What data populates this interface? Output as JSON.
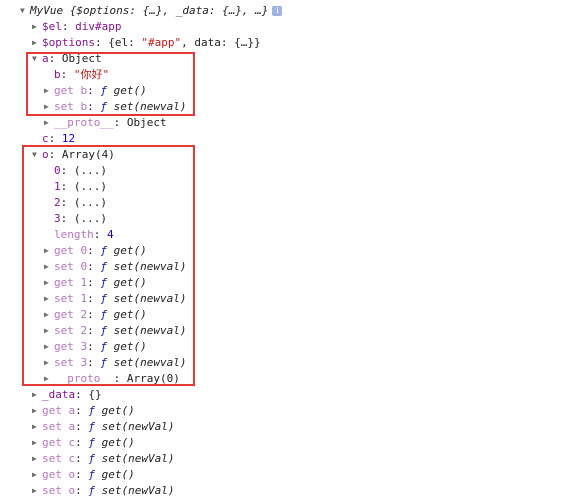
{
  "root": {
    "name": "MyVue",
    "preview": "{$options: {…}, _data: {…}, …}",
    "info": "i"
  },
  "el": {
    "key": "$el",
    "value": "div#app"
  },
  "options": {
    "key": "$options",
    "v1": "{el: ",
    "v2": "\"#app\"",
    "v3": ", data: {…}}"
  },
  "a": {
    "key": "a",
    "type": "Object",
    "b": {
      "key": "b",
      "value": "\"你好\""
    },
    "getb": {
      "label": "get b",
      "fn": "ƒ",
      "sig": "get()"
    },
    "setb": {
      "label": "set b",
      "fn": "ƒ",
      "sig": "set(newval)"
    },
    "proto": {
      "key": "__proto__",
      "value": "Object"
    }
  },
  "c": {
    "key": "c",
    "value": "12"
  },
  "o": {
    "key": "o",
    "type": "Array(4)",
    "items": [
      {
        "key": "0",
        "value": "(...)"
      },
      {
        "key": "1",
        "value": "(...)"
      },
      {
        "key": "2",
        "value": "(...)"
      },
      {
        "key": "3",
        "value": "(...)"
      }
    ],
    "length": {
      "key": "length",
      "value": "4"
    },
    "accessors": [
      {
        "label": "get 0",
        "sig": "get()"
      },
      {
        "label": "set 0",
        "sig": "set(newval)"
      },
      {
        "label": "get 1",
        "sig": "get()"
      },
      {
        "label": "set 1",
        "sig": "set(newval)"
      },
      {
        "label": "get 2",
        "sig": "get()"
      },
      {
        "label": "set 2",
        "sig": "set(newval)"
      },
      {
        "label": "get 3",
        "sig": "get()"
      },
      {
        "label": "set 3",
        "sig": "set(newval)"
      }
    ],
    "proto": {
      "key": "__proto__",
      "value": "Array(0)"
    }
  },
  "data_row": {
    "key": "_data",
    "value": "{}"
  },
  "accessors": [
    {
      "label": "get a",
      "sig": "get()"
    },
    {
      "label": "set a",
      "sig": "set(newVal)"
    },
    {
      "label": "get c",
      "sig": "get()"
    },
    {
      "label": "set c",
      "sig": "set(newVal)"
    },
    {
      "label": "get o",
      "sig": "get()"
    },
    {
      "label": "set o",
      "sig": "set(newVal)"
    }
  ],
  "fn_symbol": "ƒ",
  "colors": {
    "box": "#e53935",
    "key": "#881391",
    "string": "#c41a16",
    "number": "#1c00cf"
  }
}
